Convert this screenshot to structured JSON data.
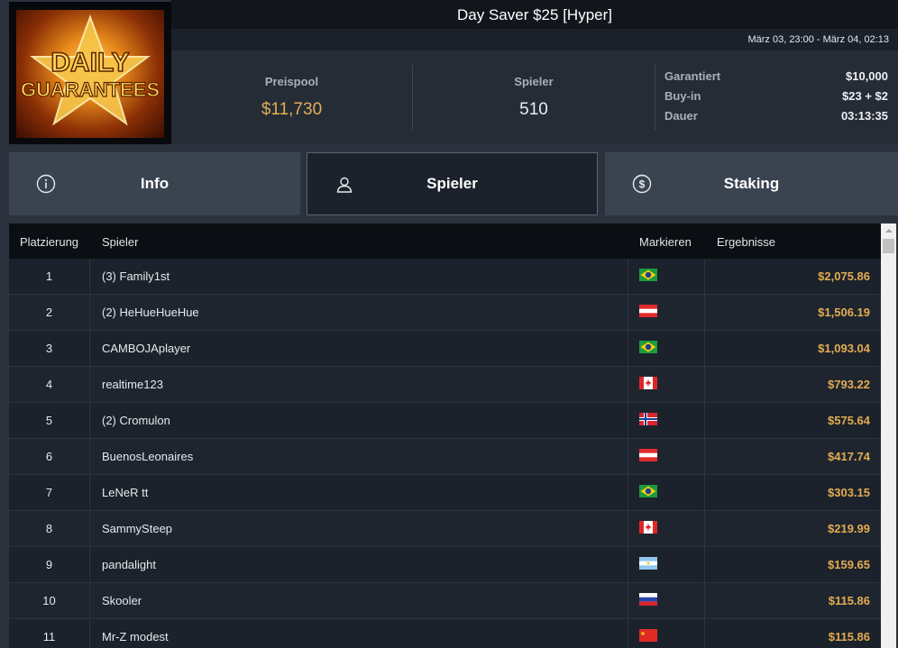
{
  "logo": {
    "line1": "DAILY",
    "line2": "GUARANTEES"
  },
  "title": "Day Saver $25 [Hyper]",
  "date_range": "März 03, 23:00 - März 04, 02:13",
  "stats": {
    "prizepool_label": "Preispool",
    "prizepool_value": "$11,730",
    "players_label": "Spieler",
    "players_value": "510"
  },
  "details": [
    {
      "key": "Garantiert",
      "value": "$10,000"
    },
    {
      "key": "Buy-in",
      "value": "$23 + $2"
    },
    {
      "key": "Dauer",
      "value": "03:13:35"
    }
  ],
  "tabs": [
    {
      "label": "Info",
      "icon": "info-icon"
    },
    {
      "label": "Spieler",
      "icon": "user-icon",
      "active": true
    },
    {
      "label": "Staking",
      "icon": "dollar-coin-icon"
    }
  ],
  "table": {
    "headers": {
      "rank": "Platzierung",
      "player": "Spieler",
      "flag": "Markieren",
      "result": "Ergebnisse"
    },
    "rows": [
      {
        "rank": "1",
        "name": "(3) Family1st",
        "flag": "brazil",
        "result": "$2,075.86"
      },
      {
        "rank": "2",
        "name": "(2) HeHueHueHue",
        "flag": "austria",
        "result": "$1,506.19"
      },
      {
        "rank": "3",
        "name": "CAMBOJAplayer",
        "flag": "brazil",
        "result": "$1,093.04"
      },
      {
        "rank": "4",
        "name": "realtime123",
        "flag": "canada",
        "result": "$793.22"
      },
      {
        "rank": "5",
        "name": "(2) Cromulon",
        "flag": "norway",
        "result": "$575.64"
      },
      {
        "rank": "6",
        "name": "BuenosLeonaires",
        "flag": "austria",
        "result": "$417.74"
      },
      {
        "rank": "7",
        "name": "LeNeR tt",
        "flag": "brazil",
        "result": "$303.15"
      },
      {
        "rank": "8",
        "name": "SammySteep",
        "flag": "canada",
        "result": "$219.99"
      },
      {
        "rank": "9",
        "name": "pandalight",
        "flag": "argentina",
        "result": "$159.65"
      },
      {
        "rank": "10",
        "name": "Skooler",
        "flag": "russia",
        "result": "$115.86"
      },
      {
        "rank": "11",
        "name": "Mr-Z modest",
        "flag": "china",
        "result": "$115.86"
      }
    ]
  },
  "colors": {
    "accent_gold": "#e2ac52",
    "background": "#2b323d",
    "header_dark": "#12161c"
  }
}
